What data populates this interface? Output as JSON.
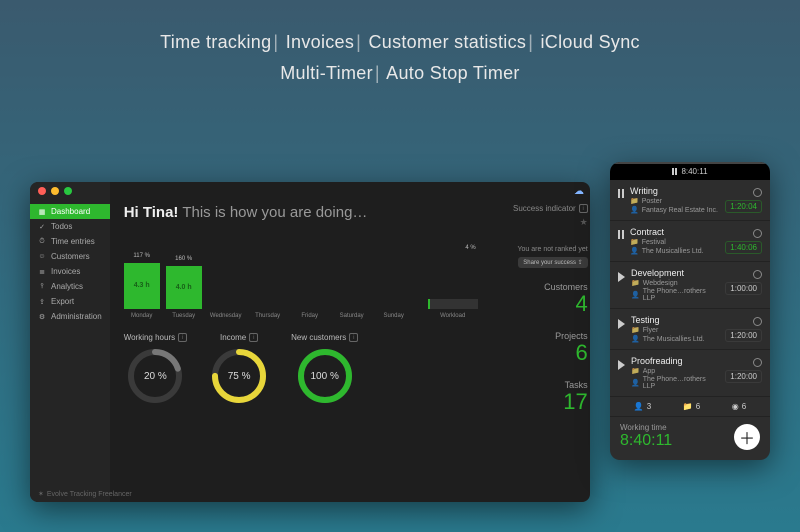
{
  "headlines": {
    "l1": [
      "Time tracking",
      "Invoices",
      "Customer statistics",
      "iCloud Sync"
    ],
    "l2": [
      "Multi-Timer",
      "Auto Stop Timer"
    ]
  },
  "sidebar": {
    "items": [
      {
        "icon": "▦",
        "label": "Dashboard",
        "active": true
      },
      {
        "icon": "✓",
        "label": "Todos"
      },
      {
        "icon": "⏱",
        "label": "Time entries"
      },
      {
        "icon": "☺",
        "label": "Customers"
      },
      {
        "icon": "≣",
        "label": "Invoices"
      },
      {
        "icon": "⫯",
        "label": "Analytics"
      },
      {
        "icon": "⇪",
        "label": "Export"
      },
      {
        "icon": "⚙",
        "label": "Administration"
      }
    ],
    "brand": "Evolve Tracking Freelancer"
  },
  "dashboard": {
    "greeting_bold": "Hi Tina!",
    "greeting_rest": " This is how you are doing…",
    "success_title": "Success indicator",
    "not_ranked": "You are not ranked yet",
    "share_label": "Share your success ⇪",
    "stats": [
      {
        "label": "Customers",
        "value": "4"
      },
      {
        "label": "Projects",
        "value": "6"
      },
      {
        "label": "Tasks",
        "value": "17"
      }
    ],
    "rings": [
      {
        "title": "Working hours",
        "pct": 20,
        "color": "#777777"
      },
      {
        "title": "Income",
        "pct": 75,
        "color": "#e8d63a"
      },
      {
        "title": "New customers",
        "pct": 100,
        "color": "#2eb82e"
      }
    ]
  },
  "chart_data": {
    "type": "bar",
    "title": "",
    "categories": [
      "Monday",
      "Tuesday",
      "Wednesday",
      "Thursday",
      "Friday",
      "Saturday",
      "Sunday"
    ],
    "series": [
      {
        "name": "Hours",
        "values": [
          4.3,
          4.0,
          0,
          0,
          0,
          0,
          0
        ],
        "labels": [
          "4.3 h",
          "4.0 h",
          "",
          "",
          "",
          "",
          ""
        ],
        "pct_labels": [
          "117 %",
          "160 %",
          "",
          "",
          "",
          "",
          ""
        ]
      }
    ],
    "workload": {
      "label": "Workload",
      "pct": 4,
      "pct_label": "4 %"
    },
    "ylim": [
      0,
      5
    ]
  },
  "timer": {
    "header_time": "8:40:11",
    "rows": [
      {
        "state": "pause",
        "name": "Writing",
        "folder": "Poster",
        "client": "Fantasy Real Estate Inc.",
        "time": "1:20:04",
        "running": true
      },
      {
        "state": "pause",
        "name": "Contract",
        "folder": "Festival",
        "client": "The Musicallies Ltd.",
        "time": "1:40:06",
        "running": true
      },
      {
        "state": "play",
        "name": "Development",
        "folder": "Webdesign",
        "client": "The Phone…rothers LLP",
        "time": "1:00:00",
        "running": false
      },
      {
        "state": "play",
        "name": "Testing",
        "folder": "Flyer",
        "client": "The Musicallies Ltd.",
        "time": "1:20:00",
        "running": false
      },
      {
        "state": "play",
        "name": "Proofreading",
        "folder": "App",
        "client": "The Phone…rothers LLP",
        "time": "1:20:00",
        "running": false
      }
    ],
    "summary": {
      "people": "3",
      "folders": "6",
      "sessions": "6"
    },
    "working_label": "Working time",
    "working_value": "8:40:11"
  }
}
